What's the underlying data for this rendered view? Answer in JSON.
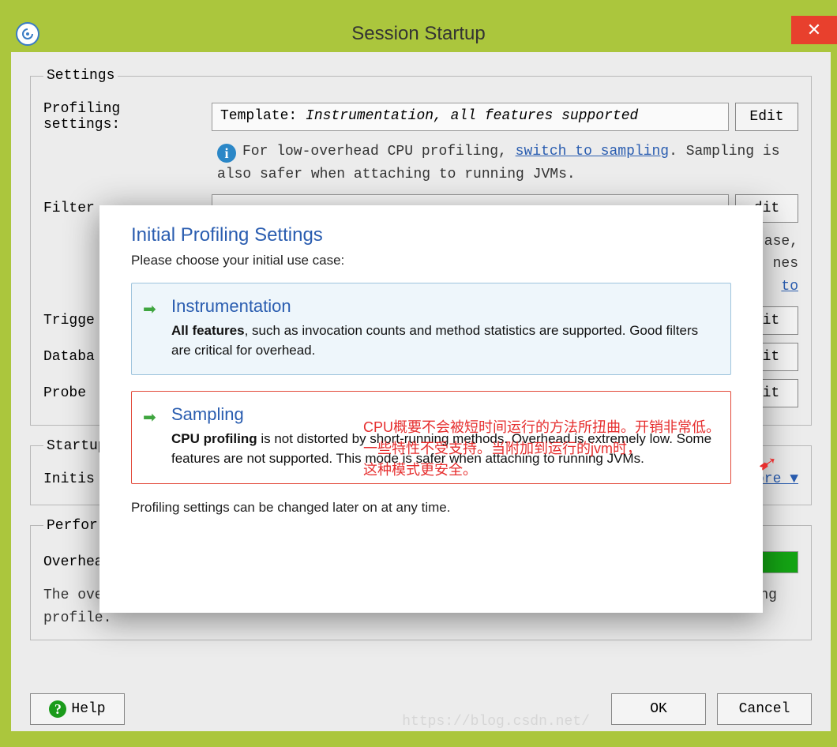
{
  "window": {
    "title": "Session Startup"
  },
  "settings_group": {
    "legend": "Settings",
    "profiling_label": "Profiling settings:",
    "profiling_template_label": "Template: ",
    "profiling_template_value": "Instrumentation, all features supported",
    "edit_label": "Edit",
    "hint_prefix": "For low-overhead CPU profiling, ",
    "hint_link": "switch to sampling",
    "hint_suffix": ". Sampling is also safer when attaching to running JVMs.",
    "filter_label": "Filter",
    "filter_hint_tail_1": "ase,",
    "filter_hint_tail_2": "nes",
    "filter_hint_tail_link": "to",
    "trigger_label": "Trigge",
    "database_label": "Databa",
    "probe_label": "Probe",
    "btn_tail": "dit"
  },
  "startup_group": {
    "legend": "Startup",
    "initial_label": "Initis",
    "more_link": "More ▼"
  },
  "perf_group": {
    "legend": "Perfor",
    "overhead_label": "Overhead:",
    "overhead_desc": "The overhead is composed of the selected profiling settings and the selected recording profile."
  },
  "footer": {
    "help": "Help",
    "ok": "OK",
    "cancel": "Cancel"
  },
  "modal": {
    "title": "Initial Profiling Settings",
    "subtitle": "Please choose your initial use case:",
    "opt1_title": "Instrumentation",
    "opt1_body_strong": "All features",
    "opt1_body_rest": ", such as invocation counts and method statistics are supported. Good filters are critical for overhead.",
    "opt2_title": "Sampling",
    "opt2_body_strong": "CPU profiling",
    "opt2_body_rest": " is not distorted by short-running methods. Overhead is extremely low. Some features are not supported. This mode is safer when attaching to running JVMs.",
    "footer": "Profiling settings can be changed later on at any time."
  },
  "annotation": {
    "line1": "CPU概要不会被短时间运行的方法所扭曲。开销非常低。",
    "line2": "一些特性不受支持。当附加到运行的jvm时，",
    "line3": "这种模式更安全。"
  },
  "watermark": "https://blog.csdn.net/"
}
